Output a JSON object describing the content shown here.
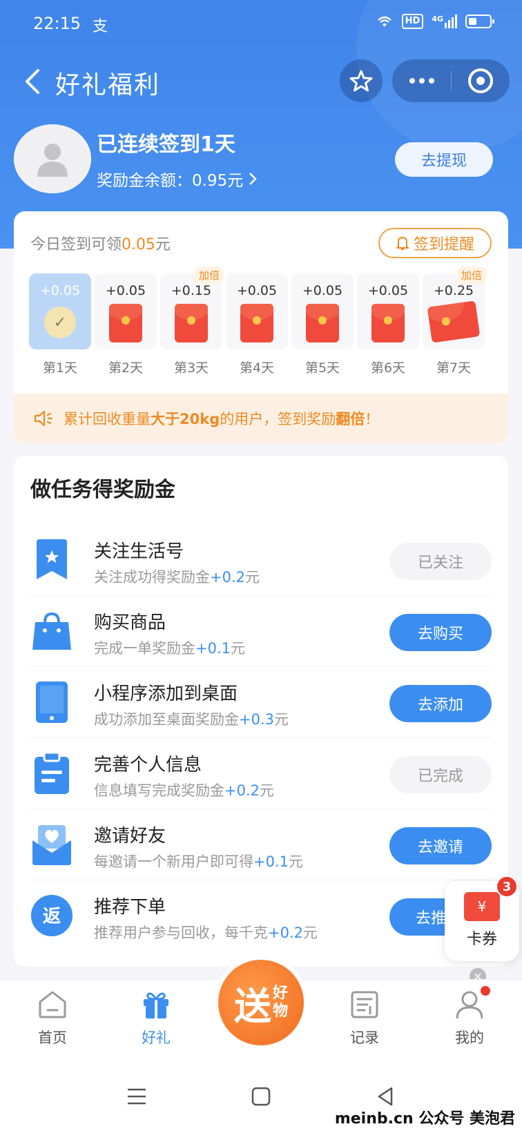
{
  "status": {
    "time": "22:15",
    "app_glyph": "支",
    "hd": "HD",
    "network": "4G"
  },
  "nav": {
    "title": "好礼福利"
  },
  "profile": {
    "streak": "已连续签到1天",
    "balance": "奖励金余额：0.95元",
    "withdraw": "去提现"
  },
  "signin": {
    "today_prefix": "今日签到可领",
    "today_amount": "0.05",
    "today_unit": "元",
    "remind": "签到提醒",
    "days": [
      {
        "reward": "+0.05",
        "label": "第1天",
        "done": true,
        "tag": ""
      },
      {
        "reward": "+0.05",
        "label": "第2天",
        "tag": ""
      },
      {
        "reward": "+0.15",
        "label": "第3天",
        "tag": "加倍"
      },
      {
        "reward": "+0.05",
        "label": "第4天",
        "tag": ""
      },
      {
        "reward": "+0.05",
        "label": "第5天",
        "tag": ""
      },
      {
        "reward": "+0.05",
        "label": "第6天",
        "tag": ""
      },
      {
        "reward": "+0.25",
        "label": "第7天",
        "tag": "加倍"
      }
    ],
    "notice_a": "累计回收重量",
    "notice_b": "大于20kg",
    "notice_c": "的用户，签到奖励",
    "notice_d": "翻倍",
    "notice_e": "！"
  },
  "tasks": {
    "title": "做任务得奖励金",
    "items": [
      {
        "name": "关注生活号",
        "desc": "关注成功得奖励金",
        "plus": "+0.2",
        "unit": "元",
        "button": "已关注",
        "icon": "bookmark-star-icon"
      },
      {
        "name": "购买商品",
        "desc": "完成一单奖励金",
        "plus": "+0.1",
        "unit": "元",
        "button": "去购买",
        "icon": "shopping-bag-icon"
      },
      {
        "name": "小程序添加到桌面",
        "desc": "成功添加至桌面奖励金",
        "plus": "+0.3",
        "unit": "元",
        "button": "去添加",
        "icon": "tablet-icon"
      },
      {
        "name": "完善个人信息",
        "desc": "信息填写完成奖励金",
        "plus": "+0.2",
        "unit": "元",
        "button": "已完成",
        "icon": "clipboard-icon"
      },
      {
        "name": "邀请好友",
        "desc": "每邀请一个新用户即可得",
        "plus": "+0.1",
        "unit": "元",
        "button": "去邀请",
        "icon": "invite-heart-icon"
      },
      {
        "name": "推荐下单",
        "desc": "推荐用户参与回收，每千克",
        "plus": "+0.2",
        "unit": "元",
        "button": "去推",
        "icon": "rebate-icon"
      }
    ]
  },
  "coupon": {
    "label": "卡券",
    "badge": "3",
    "symbol": "¥"
  },
  "tabbar": {
    "home": "首页",
    "gift": "好礼",
    "center_big": "送",
    "center_small1": "好",
    "center_small2": "物",
    "record": "记录",
    "mine": "我的"
  },
  "watermark": "meinb.cn 公众号 美泡君",
  "colors": {
    "primary": "#3b8ef0",
    "header": "#4a92f1",
    "accent": "#f08a24",
    "red": "#ef4a3b"
  }
}
